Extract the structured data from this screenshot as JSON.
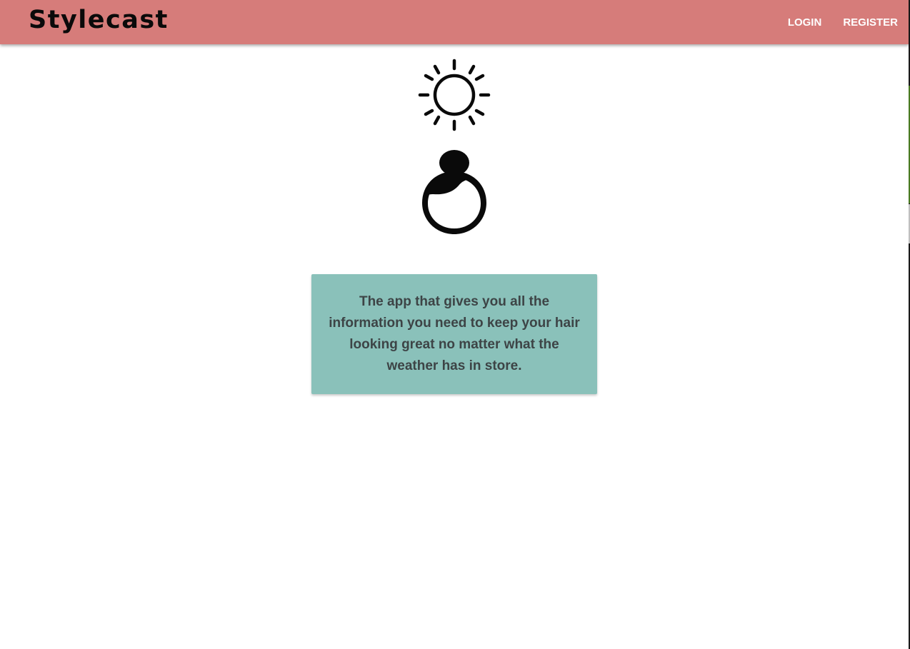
{
  "app": {
    "brand": "Stylecast"
  },
  "nav": {
    "login_label": "LOGIN",
    "register_label": "REGISTER"
  },
  "hero": {
    "weather_icon": "sun-icon",
    "hair_icon": "hair-bun-icon"
  },
  "info_card": {
    "text": "The app that gives you all the information you need to keep your hair looking great no matter what the weather has in store."
  },
  "colors": {
    "navbar_bg": "#d67c7a",
    "card_bg": "#8ac1ba",
    "icon": "#0a0a0a",
    "nav_text": "#ffffff",
    "card_text": "#3d4446"
  }
}
